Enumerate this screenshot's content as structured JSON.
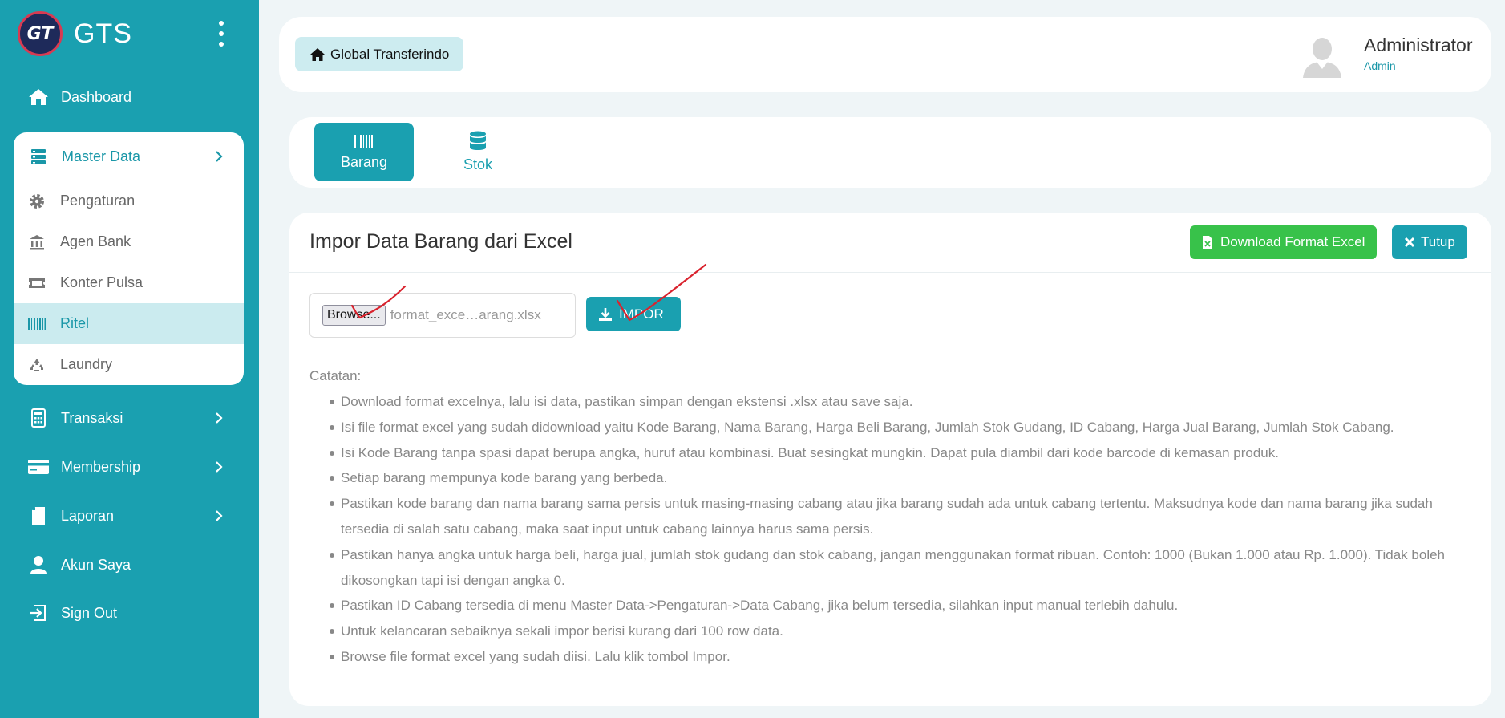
{
  "brand": {
    "name": "GTS",
    "logo_text": "GT"
  },
  "nav": {
    "dashboard": "Dashboard",
    "master_data": "Master Data",
    "sub_items": [
      "Pengaturan",
      "Agen Bank",
      "Konter Pulsa",
      "Ritel",
      "Laundry"
    ],
    "transaksi": "Transaksi",
    "membership": "Membership",
    "laporan": "Laporan",
    "akun_saya": "Akun Saya",
    "sign_out": "Sign Out"
  },
  "header": {
    "breadcrumb": "Global Transferindo",
    "user_name": "Administrator",
    "user_role": "Admin"
  },
  "tabs": [
    {
      "label": "Barang",
      "active": true
    },
    {
      "label": "Stok",
      "active": false
    }
  ],
  "card": {
    "title": "Impor Data Barang dari Excel",
    "download_label": "Download Format Excel",
    "close_label": "Tutup",
    "browse_label": "Browse...",
    "file_name": "format_exce…arang.xlsx",
    "impor_label": "IMPOR",
    "notes_label": "Catatan:",
    "notes": [
      "Download format excelnya, lalu isi data, pastikan simpan dengan ekstensi .xlsx atau save saja.",
      "Isi file format excel yang sudah didownload yaitu Kode Barang, Nama Barang, Harga Beli Barang, Jumlah Stok Gudang, ID Cabang, Harga Jual Barang, Jumlah Stok Cabang.",
      "Isi Kode Barang tanpa spasi dapat berupa angka, huruf atau kombinasi. Buat sesingkat mungkin. Dapat pula diambil dari kode barcode di kemasan produk.",
      "Setiap barang mempunya kode barang yang berbeda.",
      "Pastikan kode barang dan nama barang sama persis untuk masing-masing cabang atau jika barang sudah ada untuk cabang tertentu. Maksudnya kode dan nama barang jika sudah tersedia di salah satu cabang, maka saat input untuk cabang lainnya harus sama persis.",
      "Pastikan hanya angka untuk harga beli, harga jual, jumlah stok gudang dan stok cabang, jangan menggunakan format ribuan. Contoh: 1000 (Bukan 1.000 atau Rp. 1.000). Tidak boleh dikosongkan tapi isi dengan angka 0.",
      "Pastikan ID Cabang tersedia di menu Master Data->Pengaturan->Data Cabang, jika belum tersedia, silahkan input manual terlebih dahulu.",
      "Untuk kelancaran sebaiknya sekali impor berisi kurang dari 100 row data.",
      "Browse file format excel yang sudah diisi. Lalu klik tombol Impor."
    ]
  },
  "colors": {
    "primary": "#1aa0b0",
    "success": "#38c24a",
    "annotation": "#d9232e"
  }
}
